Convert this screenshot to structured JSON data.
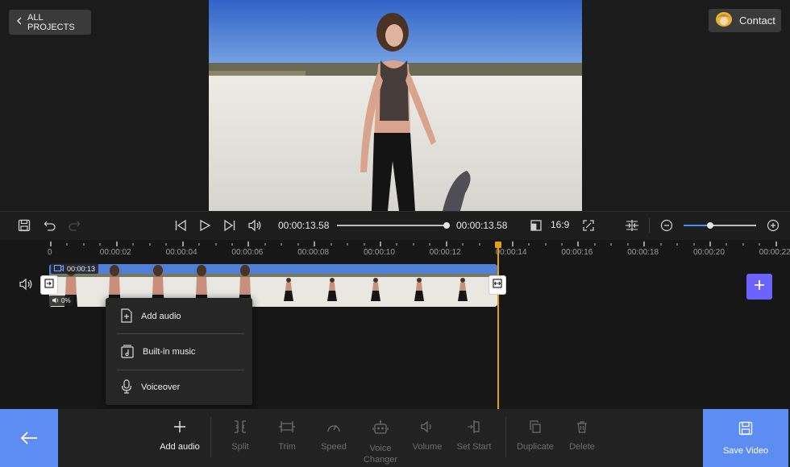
{
  "header": {
    "back_label": "ALL PROJECTS",
    "contact_label": "Contact"
  },
  "toolbar": {
    "current_time": "00:00:13.58",
    "total_time": "00:00:13.58",
    "aspect_ratio": "16:9",
    "playback_progress": 1.0,
    "zoom_level": 0.37
  },
  "timeline": {
    "ruler_labels": [
      "0",
      "00:00:02",
      "00:00:04",
      "00:00:06",
      "00:00:08",
      "00:00:10",
      "00:00:12",
      "00:00:14",
      "00:00:16",
      "00:00:18",
      "00:00:20",
      "00:00:22"
    ],
    "clip_duration": "00:00:13",
    "clip_volume": "0%"
  },
  "audio_menu": {
    "items": [
      {
        "label": "Add audio",
        "icon": "add-file-icon"
      },
      {
        "label": "Built-in music",
        "icon": "music-library-icon"
      },
      {
        "label": "Voiceover",
        "icon": "microphone-icon"
      }
    ]
  },
  "bottom_bar": {
    "add_audio": "Add audio",
    "split": "Split",
    "trim": "Trim",
    "speed": "Speed",
    "voice_changer": "Voice Changer",
    "volume": "Volume",
    "set_start": "Set Start",
    "duplicate": "Duplicate",
    "delete": "Delete",
    "save_video": "Save Video"
  },
  "colors": {
    "accent": "#5d8cf3",
    "playhead": "#e3a017",
    "add_clip": "#6b63ff"
  }
}
